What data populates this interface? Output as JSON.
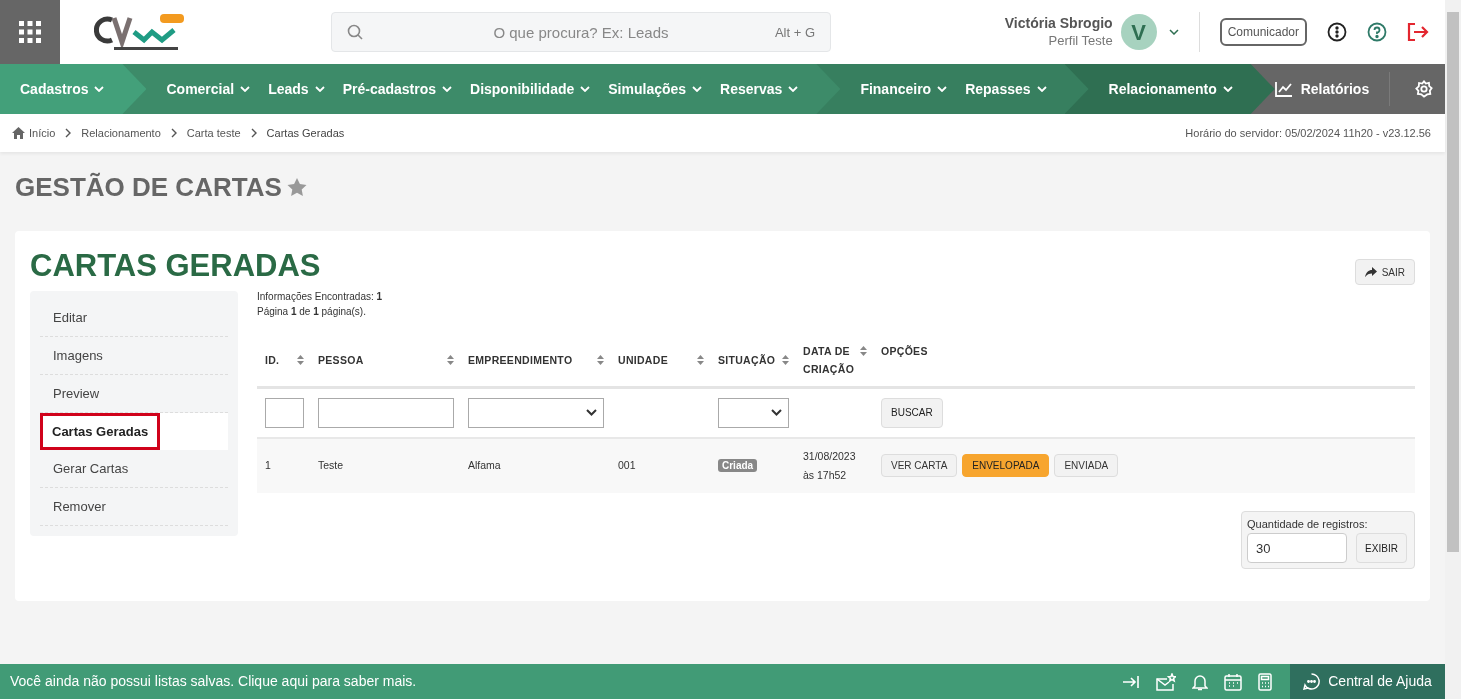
{
  "header": {
    "search": {
      "placeholder": "O que procura? Ex: Leads",
      "shortcut": "Alt + G"
    },
    "user": {
      "name": "Victória Sbrogio",
      "profile": "Perfil Teste",
      "initial": "V"
    },
    "communicator_button": "Comunicador"
  },
  "nav": {
    "groups": [
      {
        "color": "#43a07a",
        "items": [
          "Cadastros"
        ]
      },
      {
        "color": "#3d8b69",
        "items": [
          "Comercial",
          "Leads",
          "Pré-cadastros",
          "Disponibilidade",
          "Simulações",
          "Reservas"
        ]
      },
      {
        "color": "#377f5f",
        "items": [
          "Financeiro",
          "Repasses"
        ]
      },
      {
        "color": "#2f6f52",
        "items": [
          "Relacionamento"
        ]
      }
    ],
    "reports": "Relatórios"
  },
  "breadcrumb": [
    "Início",
    "Relacionamento",
    "Carta teste",
    "Cartas Geradas"
  ],
  "server_time": "Horário do servidor: 05/02/2024 11h20 - v23.12.56",
  "page_title": "GESTÃO DE CARTAS",
  "card": {
    "title": "CARTAS GERADAS",
    "exit_button": "SAIR",
    "sidebar": [
      {
        "label": "Editar",
        "selected": false
      },
      {
        "label": "Imagens",
        "selected": false
      },
      {
        "label": "Preview",
        "selected": false
      },
      {
        "label": "Cartas Geradas",
        "selected": true
      },
      {
        "label": "Gerar Cartas",
        "selected": false
      },
      {
        "label": "Remover",
        "selected": false
      }
    ],
    "summary": [
      "Informações Encontradas: **1**",
      "Página **1** de **1** página(s)."
    ],
    "table": {
      "columns": [
        {
          "label": "ID.",
          "sortable": true,
          "filter": {
            "kind": "input"
          }
        },
        {
          "label": "PESSOA",
          "sortable": true,
          "filter": {
            "kind": "input"
          }
        },
        {
          "label": "EMPREENDIMENTO",
          "sortable": true,
          "filter": {
            "kind": "select"
          }
        },
        {
          "label": "UNIDADE",
          "sortable": true
        },
        {
          "label": "SITUAÇÃO",
          "sortable": true,
          "filter": {
            "kind": "select"
          }
        },
        {
          "label": "DATA DE CRIAÇÃO",
          "sortable": true
        },
        {
          "label": "OPÇÕES",
          "sortable": false,
          "filter": {
            "kind": "button"
          }
        }
      ],
      "search_button": "BUSCAR",
      "rows": [
        {
          "cells": [
            {
              "kind": "text",
              "text": "1"
            },
            {
              "kind": "text",
              "text": "Teste"
            },
            {
              "kind": "text",
              "text": "Alfama"
            },
            {
              "kind": "text",
              "text": "001"
            },
            {
              "kind": "badge",
              "text": "Criada"
            },
            {
              "kind": "date",
              "lines": [
                "31/08/2023",
                "às 17h52"
              ]
            },
            {
              "kind": "actions",
              "buttons": [
                {
                  "label": "VER CARTA",
                  "highlighted": false
                },
                {
                  "label": "ENVELOPADA",
                  "highlighted": true
                },
                {
                  "label": "ENVIADA",
                  "highlighted": false
                }
              ]
            }
          ]
        }
      ]
    },
    "records": {
      "label": "Quantidade de registros:",
      "value": "30",
      "button": "EXIBIR"
    }
  },
  "footer": {
    "message": "Você ainda não possui listas salvas. Clique aqui para saber mais.",
    "help": "Central de Ajuda"
  }
}
